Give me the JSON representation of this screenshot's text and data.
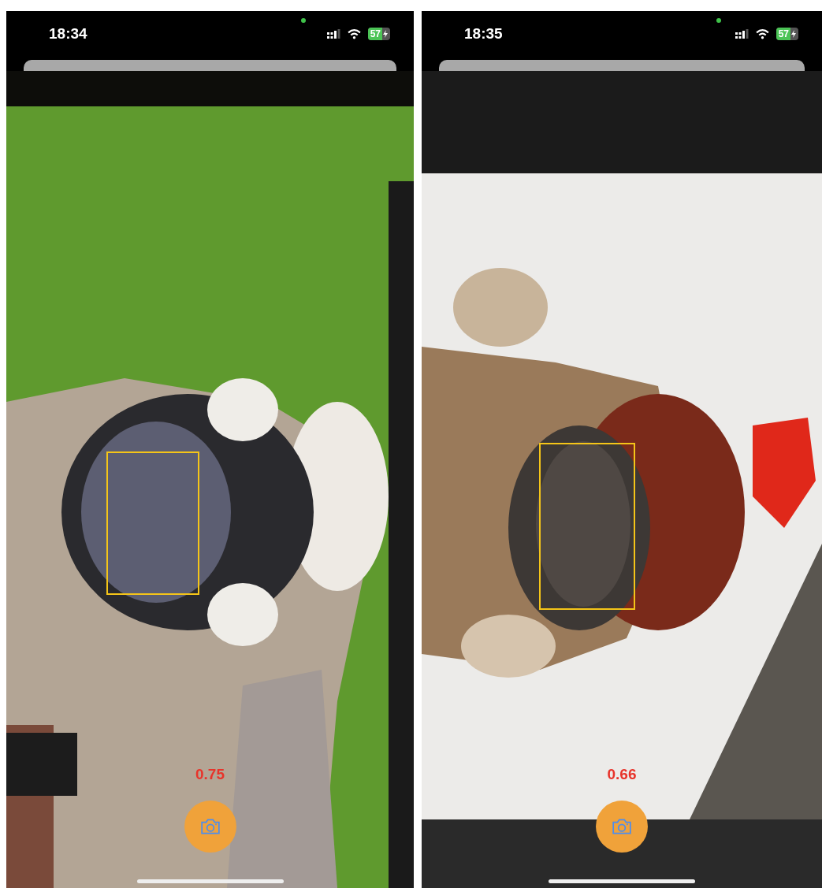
{
  "screens": [
    {
      "status_bar": {
        "time": "18:34",
        "battery": "57",
        "charging": true,
        "mic_in_use": true
      },
      "camera": {
        "score": "0.75"
      }
    },
    {
      "status_bar": {
        "time": "18:35",
        "battery": "57",
        "charging": true,
        "mic_in_use": true
      },
      "camera": {
        "score": "0.66"
      }
    }
  ]
}
